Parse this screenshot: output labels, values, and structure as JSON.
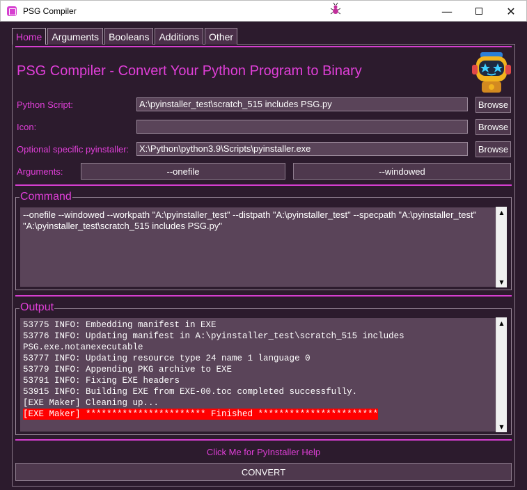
{
  "window": {
    "title": "PSG Compiler",
    "minimize_glyph": "—",
    "close_glyph": "✕"
  },
  "tabs": [
    {
      "label": "Home",
      "active": true
    },
    {
      "label": "Arguments",
      "active": false
    },
    {
      "label": "Booleans",
      "active": false
    },
    {
      "label": "Additions",
      "active": false
    },
    {
      "label": "Other",
      "active": false
    }
  ],
  "home": {
    "heading": "PSG Compiler - Convert Your Python Program to Binary",
    "python_script": {
      "label": "Python Script:",
      "value": "A:\\pyinstaller_test\\scratch_515 includes PSG.py",
      "button": "Browse"
    },
    "icon": {
      "label": "Icon:",
      "value": "",
      "button": "Browse"
    },
    "pyinstaller": {
      "label": "Optional specific pyinstaller:",
      "value": "X:\\Python\\python3.9\\Scripts\\pyinstaller.exe",
      "button": "Browse"
    },
    "arguments": {
      "label": "Arguments:",
      "onefile": "--onefile",
      "windowed": "--windowed"
    }
  },
  "command": {
    "title": "Command",
    "text": "--onefile --windowed --workpath \"A:\\pyinstaller_test\" --distpath \"A:\\pyinstaller_test\" --specpath \"A:\\pyinstaller_test\" \"A:\\pyinstaller_test\\scratch_515 includes PSG.py\""
  },
  "output": {
    "title": "Output",
    "lines": [
      "53775 INFO: Embedding manifest in EXE",
      "53776 INFO: Updating manifest in A:\\pyinstaller_test\\scratch_515 includes",
      "PSG.exe.notanexecutable",
      "53777 INFO: Updating resource type 24 name 1 language 0",
      "53779 INFO: Appending PKG archive to EXE",
      "53791 INFO: Fixing EXE headers",
      "53915 INFO: Building EXE from EXE-00.toc completed successfully.",
      "[EXE Maker] Cleaning up...",
      "[EXE Maker] *********************** Finished ***********************"
    ],
    "highlight_color": "#ff0000"
  },
  "footer": {
    "help_link": "Click Me for PyInstaller Help",
    "convert_button": "CONVERT"
  },
  "colors": {
    "background": "#2c1b2d",
    "accent": "#e03fd8",
    "field": "#5a4459"
  }
}
